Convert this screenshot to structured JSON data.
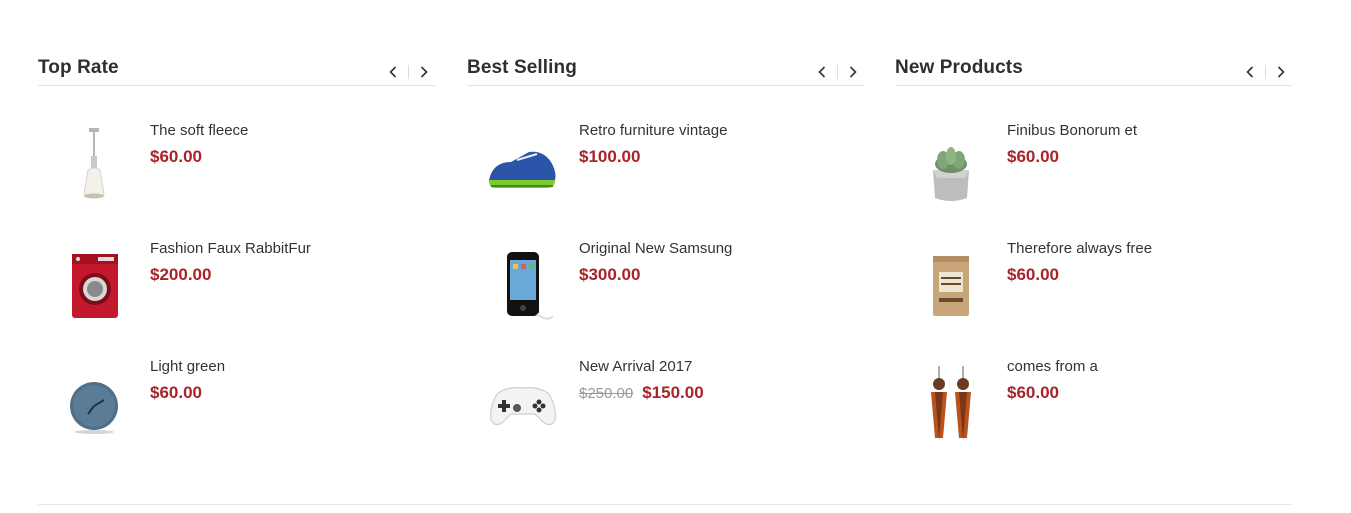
{
  "columns": [
    {
      "title": "Top Rate",
      "items": [
        {
          "name": "The soft fleece",
          "price": "$60.00",
          "old_price": "",
          "icon": "pendant-lamp-icon"
        },
        {
          "name": "Fashion Faux RabbitFur",
          "price": "$200.00",
          "old_price": "",
          "icon": "washing-machine-icon"
        },
        {
          "name": "Light green",
          "price": "$60.00",
          "old_price": "",
          "icon": "wall-clock-icon"
        }
      ]
    },
    {
      "title": "Best Selling",
      "items": [
        {
          "name": "Retro furniture vintage",
          "price": "$100.00",
          "old_price": "",
          "icon": "sneaker-icon"
        },
        {
          "name": "Original New Samsung",
          "price": "$300.00",
          "old_price": "",
          "icon": "music-player-icon"
        },
        {
          "name": "New Arrival 2017",
          "price": "$150.00",
          "old_price": "$250.00",
          "icon": "game-controller-icon"
        }
      ]
    },
    {
      "title": "New Products",
      "items": [
        {
          "name": "Finibus Bonorum et",
          "price": "$60.00",
          "old_price": "",
          "icon": "succulent-plant-icon"
        },
        {
          "name": "Therefore always free",
          "price": "$60.00",
          "old_price": "",
          "icon": "bakery-bag-icon"
        },
        {
          "name": "comes from a",
          "price": "$60.00",
          "old_price": "",
          "icon": "feather-earrings-icon"
        }
      ]
    }
  ],
  "colors": {
    "price": "#a8232a",
    "old_price": "#9a9a9a",
    "title": "#2f2f2f",
    "divider": "#e3e3e3"
  }
}
